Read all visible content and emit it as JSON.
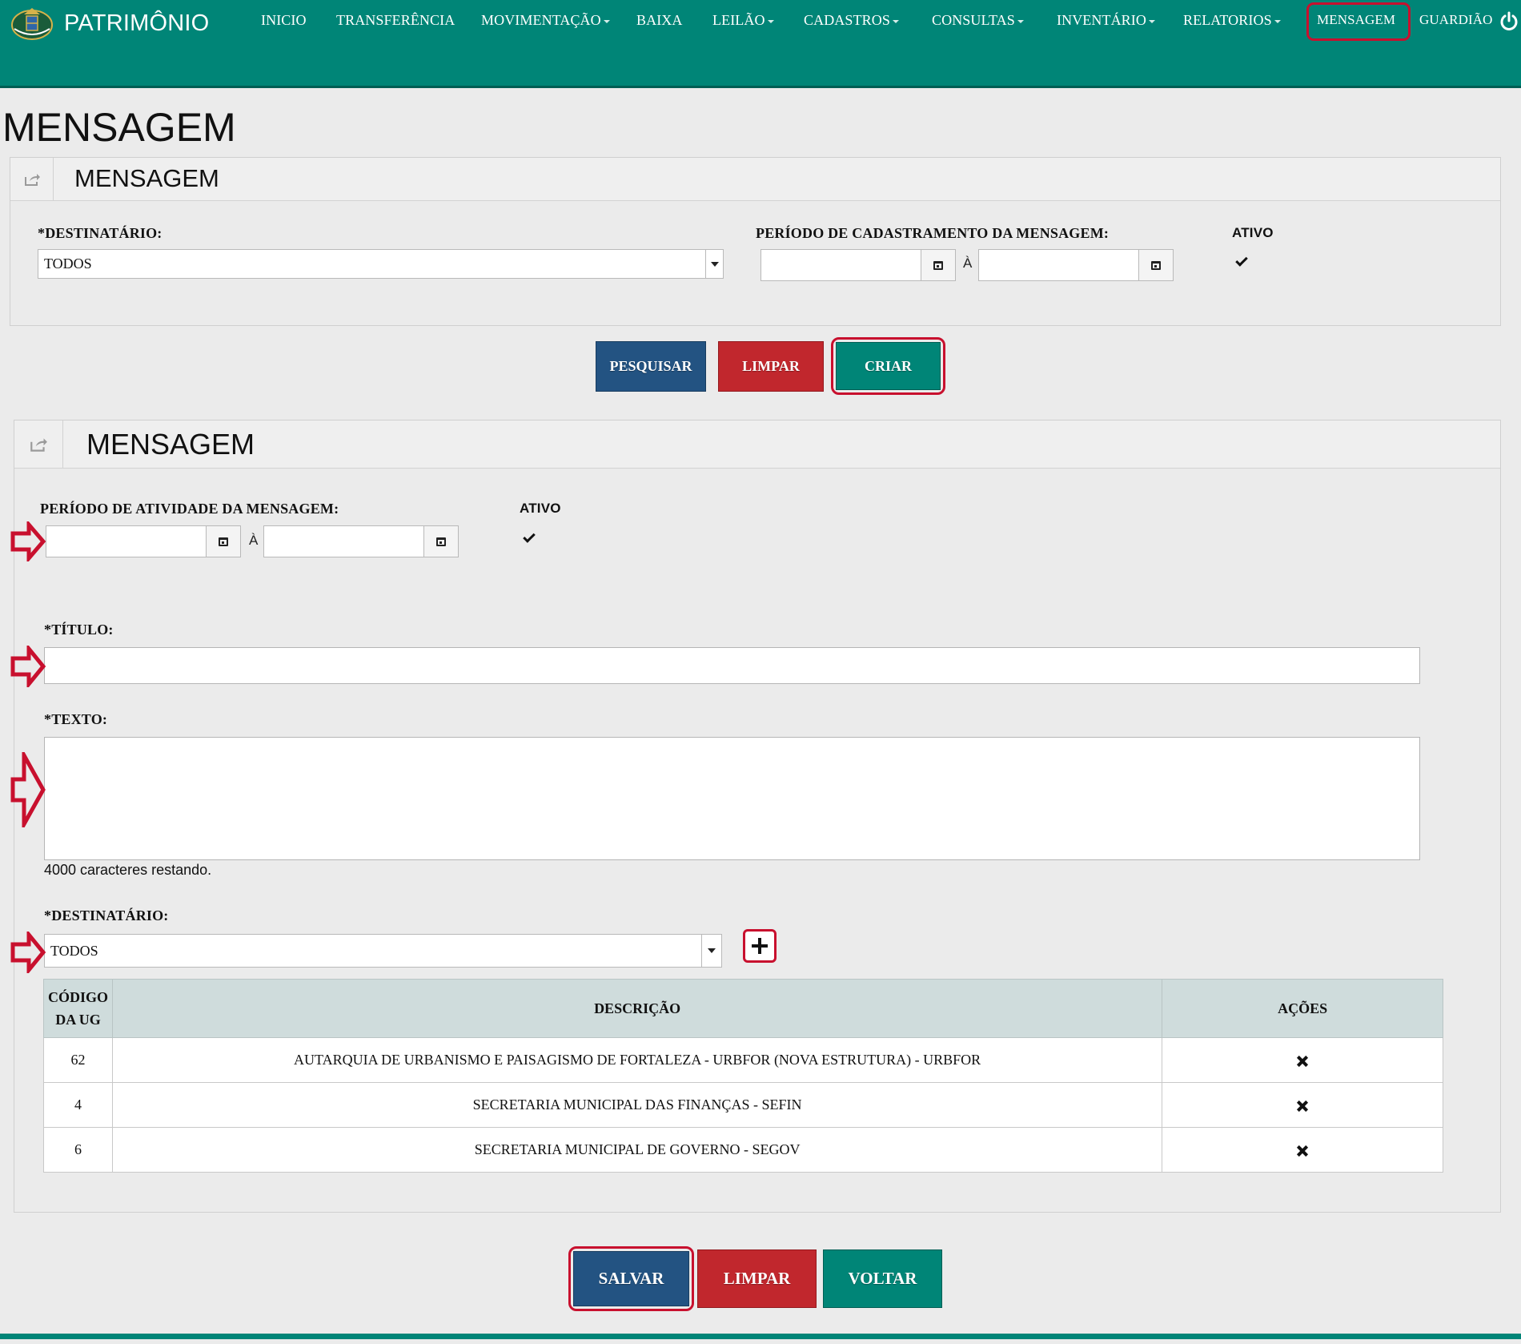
{
  "app": {
    "name": "PATRIMÔNIO",
    "nav": [
      {
        "label": "INICIO",
        "dropdown": false
      },
      {
        "label": "TRANSFERÊNCIA",
        "dropdown": false
      },
      {
        "label": "MOVIMENTAÇÃO",
        "dropdown": true
      },
      {
        "label": "BAIXA",
        "dropdown": false
      },
      {
        "label": "LEILÃO",
        "dropdown": true
      },
      {
        "label": "CADASTROS",
        "dropdown": true
      },
      {
        "label": "CONSULTAS",
        "dropdown": true
      },
      {
        "label": "INVENTÁRIO",
        "dropdown": true
      },
      {
        "label": "RELATORIOS",
        "dropdown": true
      },
      {
        "label": "MENSAGEM",
        "dropdown": false
      },
      {
        "label": "GUARDIÃO",
        "dropdown": false
      }
    ]
  },
  "page": {
    "title": "MENSAGEM"
  },
  "search_panel": {
    "title": "MENSAGEM",
    "destinatario_label": "*DESTINATÁRIO:",
    "destinatario_value": "TODOS",
    "periodo_label": "PERÍODO DE CADASTRAMENTO DA MENSAGEM:",
    "periodo_sep": "À",
    "ativo_label": "ATIVO",
    "buttons": {
      "pesquisar": "PESQUISAR",
      "limpar": "LIMPAR",
      "criar": "CRIAR"
    }
  },
  "form_panel": {
    "title": "MENSAGEM",
    "periodo_label": "PERÍODO DE ATIVIDADE DA MENSAGEM:",
    "periodo_sep": "À",
    "ativo_label": "ATIVO",
    "titulo_label": "*TÍTULO:",
    "texto_label": "*TEXTO:",
    "counter_text": "4000 caracteres restando.",
    "destinatario_label": "*DESTINATÁRIO:",
    "destinatario_value": "TODOS",
    "table": {
      "headers": {
        "codigo_line1": "CÓDIGO",
        "codigo_line2": "DA UG",
        "descricao": "DESCRIÇÃO",
        "acoes": "AÇÕES"
      },
      "rows": [
        {
          "codigo": "62",
          "descricao": "AUTARQUIA DE URBANISMO E PAISAGISMO DE FORTALEZA - URBFOR (NOVA ESTRUTURA) - URBFOR"
        },
        {
          "codigo": "4",
          "descricao": "SECRETARIA MUNICIPAL DAS FINANÇAS - SEFIN"
        },
        {
          "codigo": "6",
          "descricao": "SECRETARIA MUNICIPAL DE GOVERNO - SEGOV"
        }
      ]
    },
    "buttons": {
      "salvar": "SALVAR",
      "limpar": "LIMPAR",
      "voltar": "VOLTAR"
    }
  },
  "icons": {
    "logo": "coat-of-arms-logo",
    "power": "power-icon",
    "share": "share-icon",
    "calendar": "calendar-icon",
    "remove": "close-icon",
    "add": "plus-icon",
    "annotation": "arrow-right-icon"
  },
  "colors": {
    "header": "#008577",
    "primary": "#235382",
    "danger": "#c1272d",
    "accent": "#008577",
    "highlight": "#c8102e"
  }
}
